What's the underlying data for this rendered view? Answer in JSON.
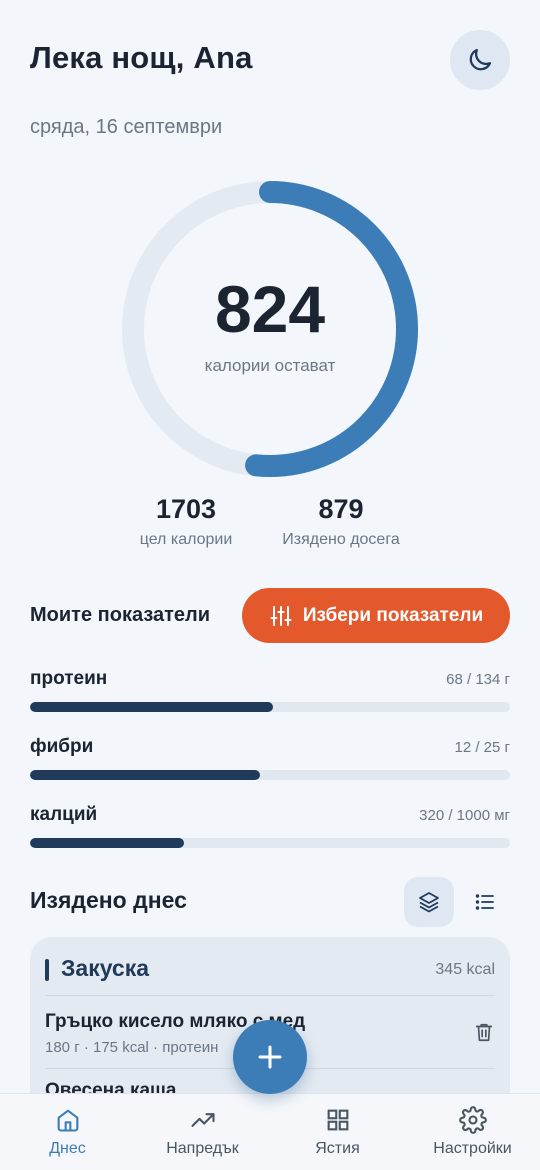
{
  "header": {
    "greeting": "Лека нощ, Ana",
    "date": "сряда, 16 септември",
    "theme_icon": "moon-icon"
  },
  "calories": {
    "remaining": "824",
    "remaining_label": "калории остават",
    "goal": "1703",
    "goal_label": "цел калории",
    "eaten": "879",
    "eaten_label": "Изядено досега",
    "eaten_fraction": 0.516
  },
  "metrics": {
    "title": "Моите показатели",
    "choose_label": "Избери показатели",
    "items": [
      {
        "name": "протеин",
        "value": "68 / 134 г",
        "fraction": 0.507
      },
      {
        "name": "фибри",
        "value": "12 / 25 г",
        "fraction": 0.48
      },
      {
        "name": "калций",
        "value": "320 / 1000 мг",
        "fraction": 0.32
      }
    ]
  },
  "eaten_today": {
    "title": "Изядено днес",
    "meal": {
      "name": "Закуска",
      "kcal": "345 kcal",
      "foods": [
        {
          "name": "Гръцко кисело мляко с мед",
          "meta": "180 г · 175 kcal · протеин"
        },
        {
          "name": "Овесена каша"
        }
      ]
    }
  },
  "nav": {
    "items": [
      {
        "label": "Днес",
        "icon": "home-icon"
      },
      {
        "label": "Напредък",
        "icon": "trending-up-icon"
      },
      {
        "label": "Ястия",
        "icon": "grid-icon"
      },
      {
        "label": "Настройки",
        "icon": "gear-icon"
      }
    ]
  },
  "colors": {
    "accent": "#3c7db8",
    "orange": "#e3592b",
    "dark_bar": "#1f3a5a",
    "track": "#e2e8f0"
  }
}
